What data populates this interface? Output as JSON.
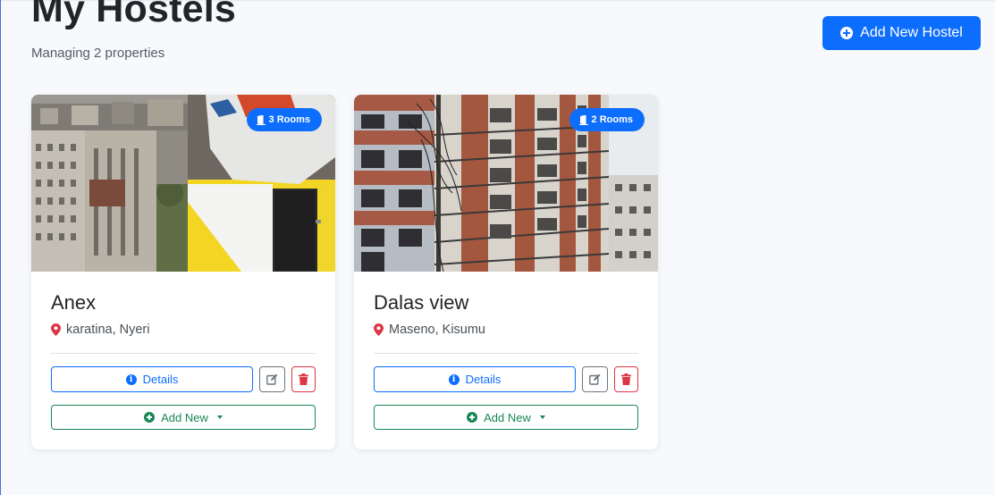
{
  "header": {
    "title": "My Hostels",
    "subtitle": "Managing 2 properties",
    "add_button_label": "Add New Hostel"
  },
  "colors": {
    "primary": "#0d6efd",
    "success": "#198754",
    "danger": "#dc3545",
    "secondary": "#6c757d"
  },
  "hostels": [
    {
      "name": "Anex",
      "location": "karatina, Nyeri",
      "rooms_badge": "3 Rooms",
      "details_label": "Details",
      "add_new_label": "Add New"
    },
    {
      "name": "Dalas view",
      "location": "Maseno, Kisumu",
      "rooms_badge": "2 Rooms",
      "details_label": "Details",
      "add_new_label": "Add New"
    }
  ],
  "icons": {
    "add": "plus-circle-icon",
    "door": "door-open-icon",
    "location": "map-pin-icon",
    "info": "info-circle-icon",
    "edit": "edit-icon",
    "delete": "trash-icon",
    "dropdown": "caret-down-icon"
  }
}
